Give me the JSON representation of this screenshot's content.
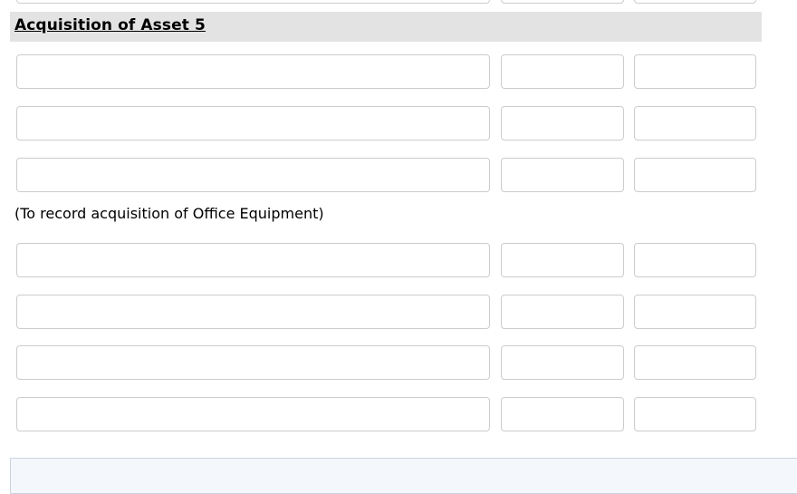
{
  "sheet": {
    "section": {
      "title": "Acquisition of Asset 5"
    },
    "memo": {
      "text": "(To record acquisition of Office Equipment)"
    },
    "columns": [
      {
        "key": "description",
        "label": ""
      },
      {
        "key": "debit",
        "label": ""
      },
      {
        "key": "credit",
        "label": ""
      }
    ],
    "clipped_top_row": {
      "description": "",
      "debit": "",
      "credit": ""
    },
    "entry_rows_upper": [
      {
        "description": "",
        "debit": "",
        "credit": ""
      },
      {
        "description": "",
        "debit": "",
        "credit": ""
      },
      {
        "description": "",
        "debit": "",
        "credit": ""
      }
    ],
    "entry_rows_lower": [
      {
        "description": "",
        "debit": "",
        "credit": ""
      },
      {
        "description": "",
        "debit": "",
        "credit": ""
      },
      {
        "description": "",
        "debit": "",
        "credit": ""
      },
      {
        "description": "",
        "debit": "",
        "credit": ""
      }
    ],
    "info_panel": {
      "text": ""
    },
    "colors": {
      "section_band": "#e3e3e3",
      "field_border": "#cccccc",
      "field_background": "#ffffff",
      "page_background": "#ffffff",
      "info_panel_background": "#f4f7fb",
      "info_panel_border": "#ccd4e0",
      "text": "#000000"
    }
  }
}
